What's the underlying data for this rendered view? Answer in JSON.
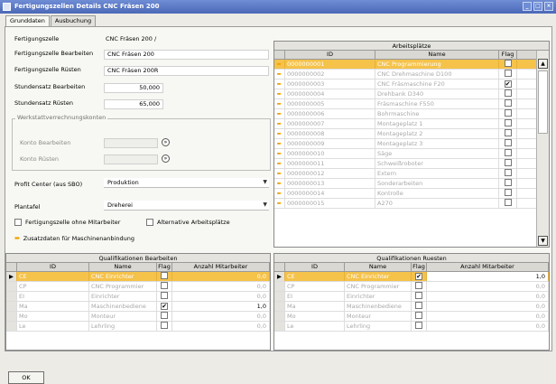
{
  "window": {
    "title": "Fertigungszellen Details CNC Fräsen 200"
  },
  "tabs": [
    {
      "label": "Grunddaten"
    },
    {
      "label": "Ausbuchung"
    }
  ],
  "form": {
    "fertigungszelle_label": "Fertigungszelle",
    "fertigungszelle_value": "CNC Fräsen 200 /",
    "bearbeiten_label": "Fertigungszelle Bearbeiten",
    "bearbeiten_value": "CNC Fräsen 200",
    "ruesten_label": "Fertigungszelle Rüsten",
    "ruesten_value": "CNC Fräsen 200R",
    "stundensatz_bearbeiten_label": "Stundensatz Bearbeiten",
    "stundensatz_bearbeiten_value": "50,000",
    "stundensatz_ruesten_label": "Stundensatz Rüsten",
    "stundensatz_ruesten_value": "65,000",
    "werkstatt_group_label": "Werkstattverrechnungskonten",
    "konto_bearbeiten_label": "Konto Bearbeiten",
    "konto_ruesten_label": "Konto Rüsten",
    "profit_center_label": "Profit Center (aus SBO)",
    "profit_center_value": "Produktion",
    "plantafel_label": "Plantafel",
    "plantafel_value": "Dreherei",
    "ohne_mitarbeiter_label": "Fertigungszelle ohne Mitarbeiter",
    "alternative_label": "Alternative Arbeitsplätze",
    "zusatzdaten_label": "Zusatzdaten für Maschinenanbindung"
  },
  "arbeitsplaetze": {
    "title": "Arbeitsplätze",
    "columns": [
      "ID",
      "Name",
      "Flag"
    ],
    "rows": [
      {
        "id": "0000000001",
        "name": "CNC Programmierung",
        "flag": false
      },
      {
        "id": "0000000002",
        "name": "CNC Drehmaschine D100",
        "flag": false
      },
      {
        "id": "0000000003",
        "name": "CNC Fräsmaschine F20",
        "flag": true
      },
      {
        "id": "0000000004",
        "name": "Drehbank D340",
        "flag": false
      },
      {
        "id": "0000000005",
        "name": "Fräsmaschine F550",
        "flag": false
      },
      {
        "id": "0000000006",
        "name": "Bohrmaschine",
        "flag": false
      },
      {
        "id": "0000000007",
        "name": "Montageplatz 1",
        "flag": false
      },
      {
        "id": "0000000008",
        "name": "Montageplatz 2",
        "flag": false
      },
      {
        "id": "0000000009",
        "name": "Montageplatz 3",
        "flag": false
      },
      {
        "id": "0000000010",
        "name": "Säge",
        "flag": false
      },
      {
        "id": "0000000011",
        "name": "Schweißroboter",
        "flag": false
      },
      {
        "id": "0000000012",
        "name": "Extern",
        "flag": false
      },
      {
        "id": "0000000013",
        "name": "Sonderarbeiten",
        "flag": false
      },
      {
        "id": "0000000014",
        "name": "Kontrolle",
        "flag": false
      },
      {
        "id": "0000000015",
        "name": "A270",
        "flag": false
      }
    ]
  },
  "qual_bearbeiten": {
    "title": "Qualifikationen Bearbeiten",
    "columns": [
      "ID",
      "Name",
      "Flag",
      "Anzahl Mitarbeiter"
    ],
    "rows": [
      {
        "id": "CE",
        "name": "CNC Einrichter",
        "flag": false,
        "anzahl": "0,0"
      },
      {
        "id": "CP",
        "name": "CNC Programmier",
        "flag": false,
        "anzahl": "0,0"
      },
      {
        "id": "EI",
        "name": "Einrichter",
        "flag": false,
        "anzahl": "0,0"
      },
      {
        "id": "Ma",
        "name": "Maschinenbediene",
        "flag": true,
        "anzahl": "1,0"
      },
      {
        "id": "Mo",
        "name": "Monteur",
        "flag": false,
        "anzahl": "0,0"
      },
      {
        "id": "Le",
        "name": "Lehrling",
        "flag": false,
        "anzahl": "0,0"
      }
    ]
  },
  "qual_ruesten": {
    "title": "Qualifikationen Ruesten",
    "columns": [
      "ID",
      "Name",
      "Flag",
      "Anzahl Mitarbeiter"
    ],
    "rows": [
      {
        "id": "CE",
        "name": "CNC Einrichter",
        "flag": true,
        "anzahl": "1,0"
      },
      {
        "id": "CP",
        "name": "CNC Programmier",
        "flag": false,
        "anzahl": "0,0"
      },
      {
        "id": "EI",
        "name": "Einrichter",
        "flag": false,
        "anzahl": "0,0"
      },
      {
        "id": "Ma",
        "name": "Maschinenbediene",
        "flag": false,
        "anzahl": "0,0"
      },
      {
        "id": "Mo",
        "name": "Monteur",
        "flag": false,
        "anzahl": "0,0"
      },
      {
        "id": "Le",
        "name": "Lehrling",
        "flag": false,
        "anzahl": "0,0"
      }
    ]
  },
  "buttons": {
    "ok": "OK"
  },
  "icons": {
    "row_arrow": "arrow-right-icon",
    "row_pointer": "row-pointer-icon",
    "check": "check-icon",
    "lookup": "lookup-icon"
  },
  "colors": {
    "title_bar": "#5a78c6",
    "selection": "#f5c24a",
    "arrow": "#f0a000"
  }
}
